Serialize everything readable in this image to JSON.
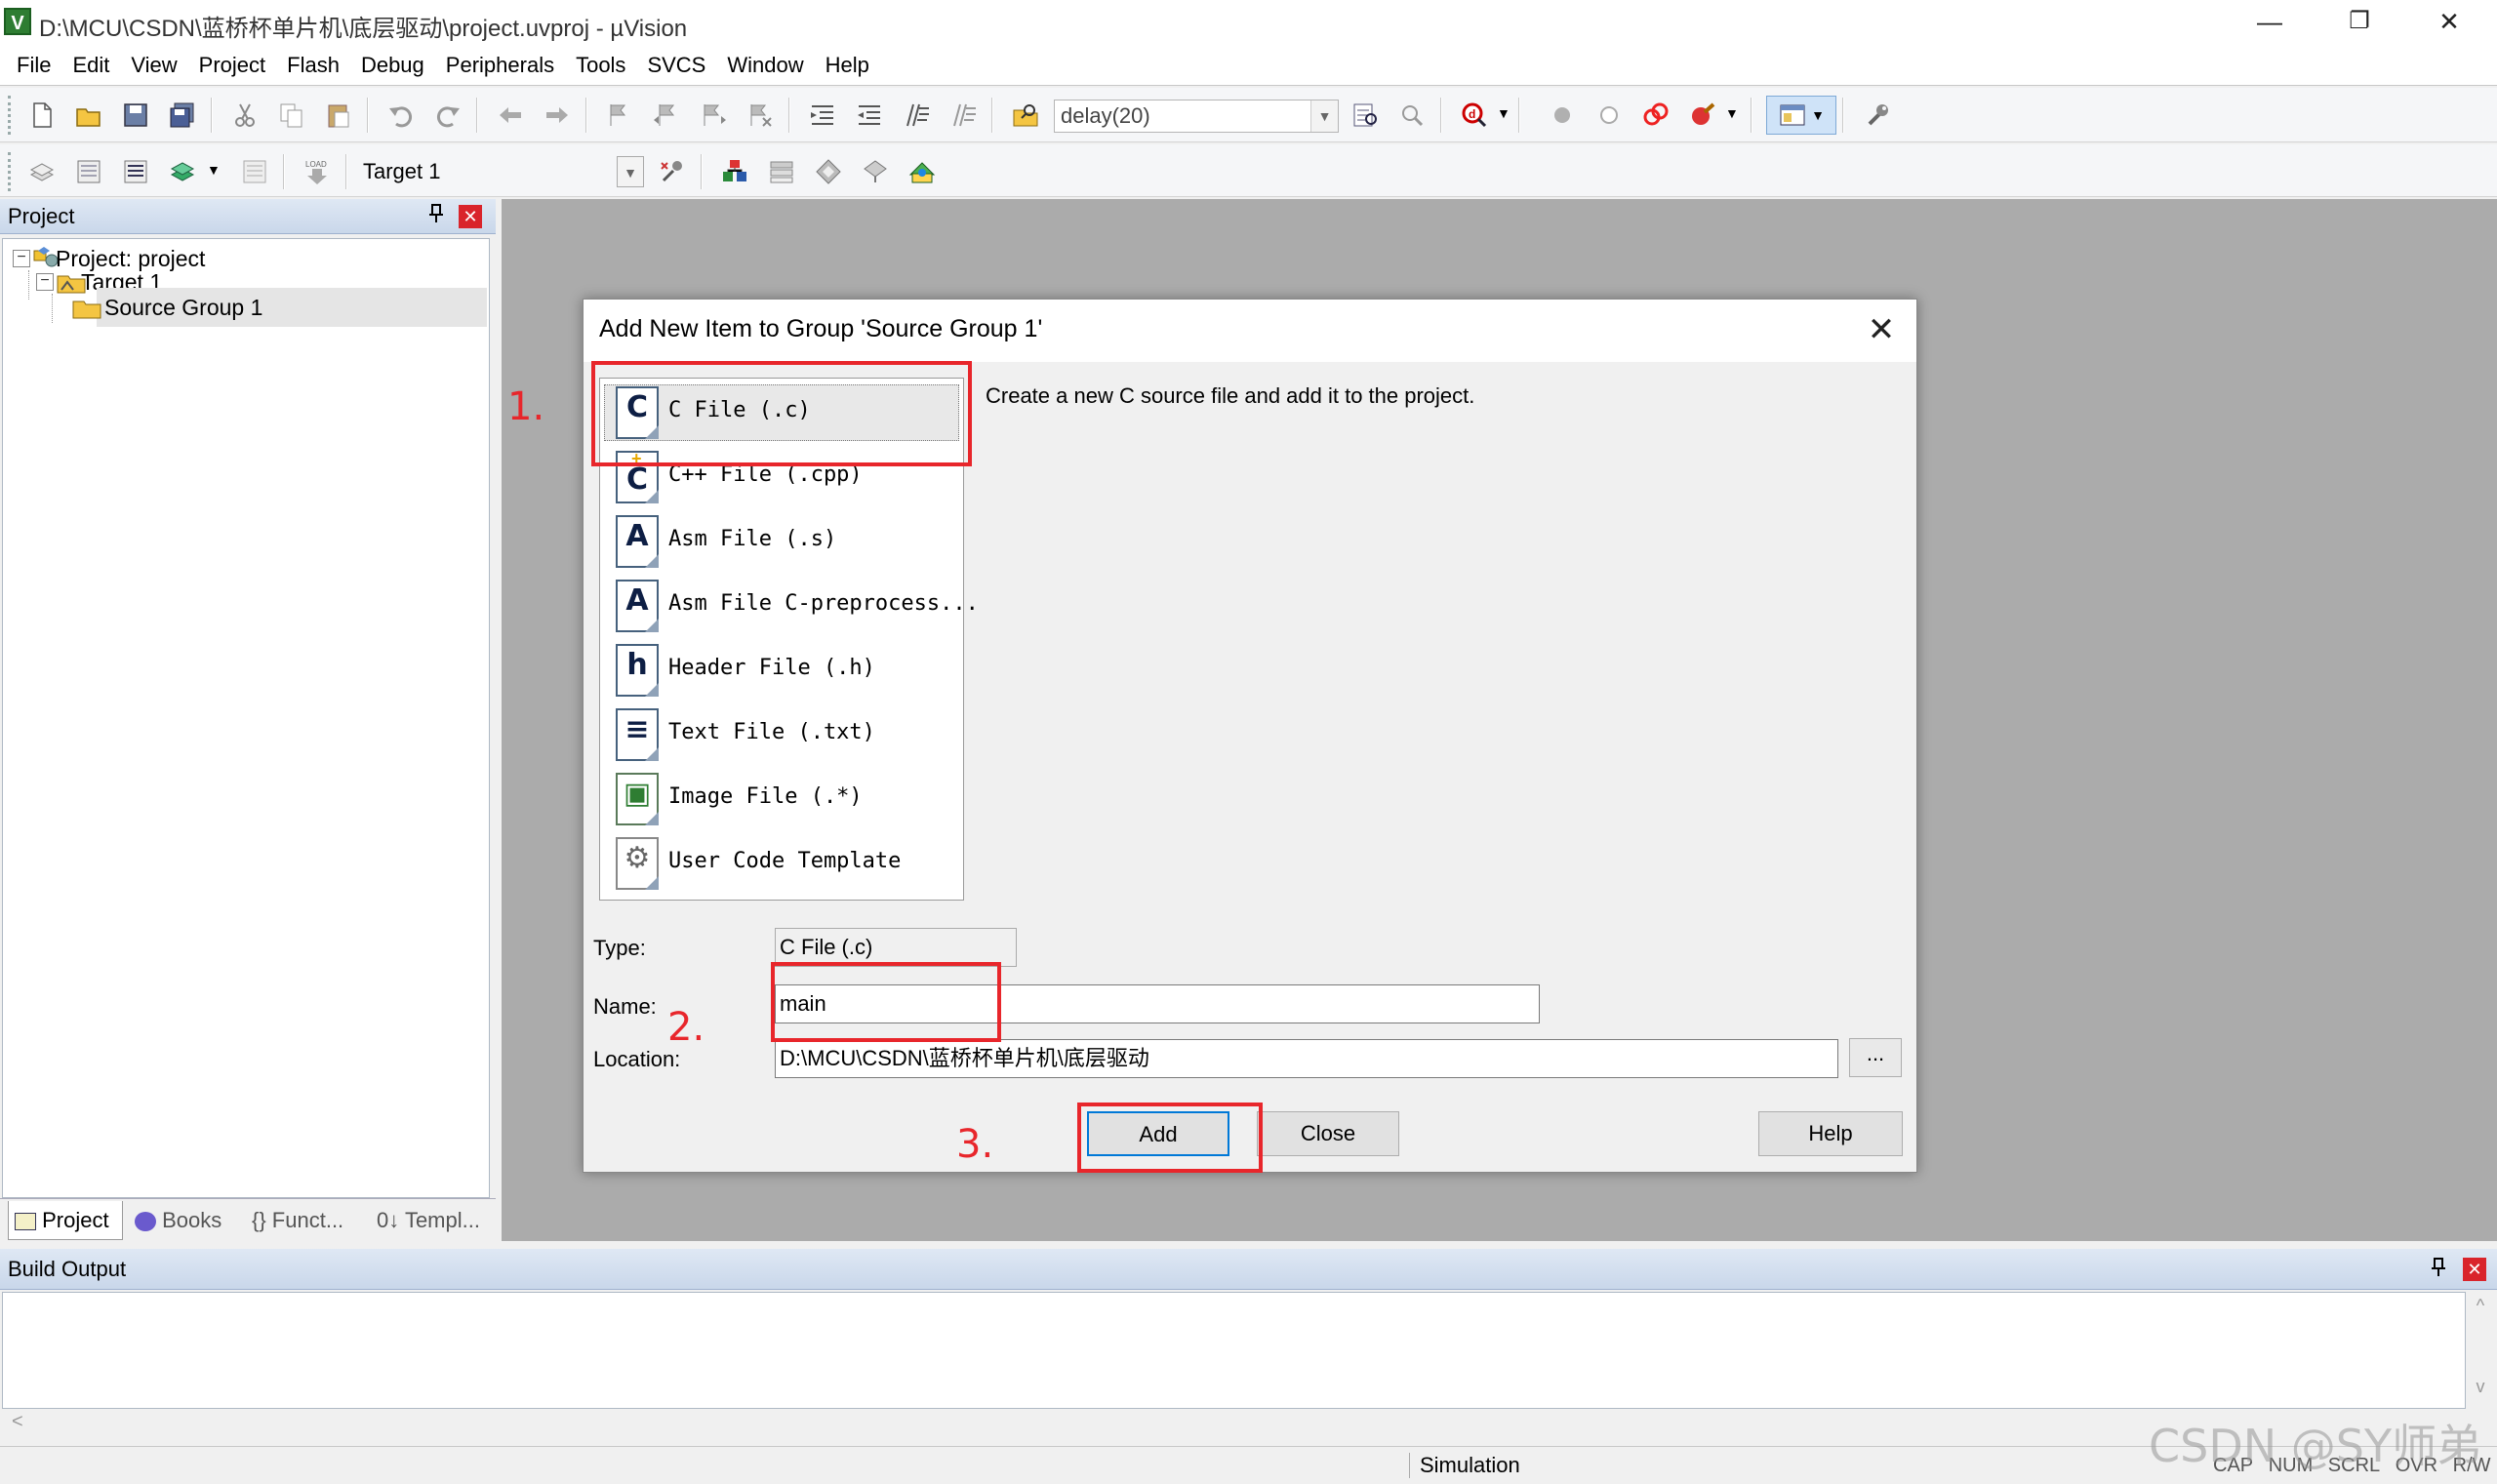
{
  "window": {
    "title": "D:\\MCU\\CSDN\\蓝桥杯单片机\\底层驱动\\project.uvproj - µVision",
    "app_icon": "V",
    "minimize_glyph": "—",
    "restore_glyph": "❐",
    "close_glyph": "✕"
  },
  "menu": [
    "File",
    "Edit",
    "View",
    "Project",
    "Flash",
    "Debug",
    "Peripherals",
    "Tools",
    "SVCS",
    "Window",
    "Help"
  ],
  "toolbar": {
    "find_combo": "delay(20)",
    "target_combo": "Target 1",
    "icons": [
      "new-file-icon",
      "open-file-icon",
      "save-icon",
      "save-all-icon",
      "cut-icon",
      "copy-icon",
      "paste-icon",
      "undo-icon",
      "redo-icon",
      "nav-back-icon",
      "nav-forward-icon",
      "bookmark-icon",
      "bookmark-prev-icon",
      "bookmark-next-icon",
      "bookmark-clear-icon",
      "indent-icon",
      "unindent-icon",
      "comment-icon",
      "uncomment-icon",
      "find-in-files-icon",
      "find-icon",
      "incremental-find-icon",
      "debug-session-icon",
      "breakpoint-icon",
      "breakpoint-disable-icon",
      "breakpoint-kill-icon",
      "breakpoint-clear-icon",
      "window-layout-icon",
      "configure-icon"
    ]
  },
  "project_panel": {
    "header": "Project",
    "pin_glyph": "📌",
    "close_glyph": "✕",
    "tree": [
      {
        "label": "Project: project",
        "toggle": "−"
      },
      {
        "label": "Target 1",
        "toggle": "−"
      },
      {
        "label": "Source Group 1",
        "toggle": ""
      }
    ],
    "tabs": [
      "Project",
      "Books",
      "{} Funct...",
      "0↓ Templ..."
    ]
  },
  "dialog": {
    "title": "Add New Item to Group 'Source Group 1'",
    "close_glyph": "✕",
    "description": "Create a new C source file and add it to the project.",
    "items": [
      {
        "letter": "C",
        "label": "C File (.c)"
      },
      {
        "letter": "C",
        "label": "C++ File (.cpp)"
      },
      {
        "letter": "A",
        "label": "Asm File (.s)"
      },
      {
        "letter": "A",
        "label": "Asm File C-preprocess..."
      },
      {
        "letter": "h",
        "label": "Header File (.h)"
      },
      {
        "letter": "≡",
        "label": "Text File (.txt)"
      },
      {
        "letter": "▣",
        "label": "Image File (.*)"
      },
      {
        "letter": "⚙",
        "label": "User Code Template"
      }
    ],
    "type_label": "Type:",
    "type_value": "C File (.c)",
    "name_label": "Name:",
    "name_value": "main",
    "location_label": "Location:",
    "location_value": "D:\\MCU\\CSDN\\蓝桥杯单片机\\底层驱动",
    "browse_label": "...",
    "add_label": "Add",
    "close_label": "Close",
    "help_label": "Help"
  },
  "annotations": [
    "1.",
    "2.",
    "3."
  ],
  "annotation_color": "#e8262b",
  "build_output": {
    "header": "Build Output",
    "pin_glyph": "📌",
    "close_glyph": "✕",
    "scroll_up": "^",
    "scroll_down": "v",
    "scroll_left": "<"
  },
  "statusbar": {
    "mode": "Simulation",
    "flags": [
      "CAP",
      "NUM",
      "SCRL",
      "OVR",
      "R/W"
    ]
  },
  "watermark": "CSDN @SY师弟"
}
